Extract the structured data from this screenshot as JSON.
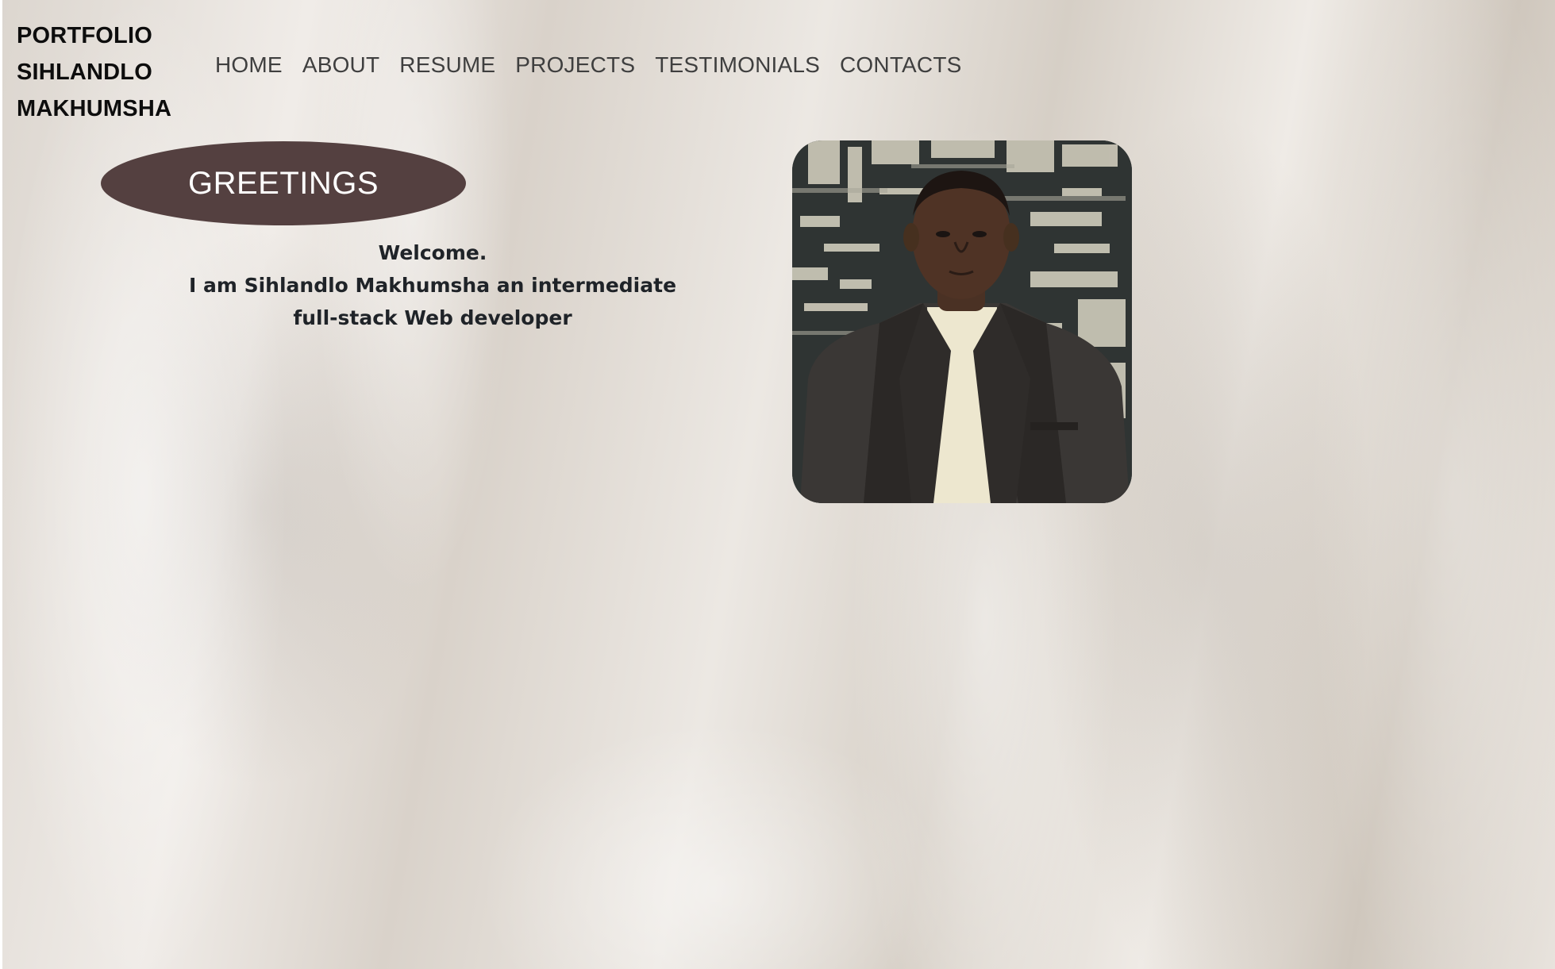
{
  "brand": {
    "line1": "PORTFOLIO",
    "line2": "SIHLANDLO",
    "line3": "MAKHUMSHA"
  },
  "nav": {
    "items": [
      {
        "label": "HOME"
      },
      {
        "label": "ABOUT"
      },
      {
        "label": "RESUME"
      },
      {
        "label": "PROJECTS"
      },
      {
        "label": "TESTIMONIALS"
      },
      {
        "label": "CONTACTS"
      }
    ]
  },
  "hero": {
    "greeting_button": "GREETINGS",
    "intro_line1": "Welcome.",
    "intro_line2": "I am Sihlandlo Makhumsha an intermediate",
    "intro_line3": "full-stack Web developer"
  },
  "colors": {
    "greeting_bg": "#544040",
    "nav_text": "#3f3f3f",
    "intro_text": "#1f2328",
    "page_bg": "#e6e1dc"
  },
  "images": {
    "profile_photo": "portrait-photo"
  }
}
